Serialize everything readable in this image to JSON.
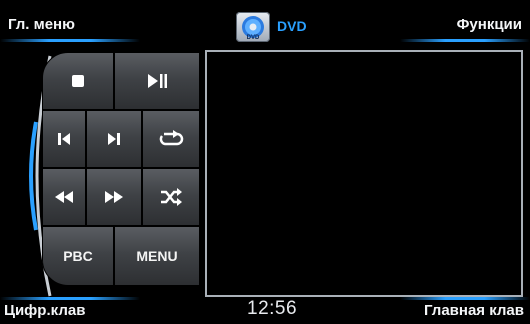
{
  "header": {
    "main_menu_label": "Гл. меню",
    "source_label": "DVD",
    "functions_label": "Функции",
    "source_icon": "dvd-disc-icon"
  },
  "controls": {
    "stop_icon": "stop-icon",
    "play_pause_icon": "play-pause-icon",
    "prev_track_icon": "skip-previous-icon",
    "next_track_icon": "skip-next-icon",
    "repeat_icon": "repeat-icon",
    "rewind_icon": "rewind-icon",
    "fast_forward_icon": "fast-forward-icon",
    "shuffle_icon": "shuffle-icon",
    "pbc_label": "PBC",
    "menu_label": "MENU"
  },
  "footer": {
    "numpad_label": "Цифр.клав",
    "clock": "12:56",
    "main_keyboard_label": "Главная клав"
  },
  "colors": {
    "accent": "#2aa0ff",
    "button": "#3f4246",
    "background": "#000000"
  }
}
